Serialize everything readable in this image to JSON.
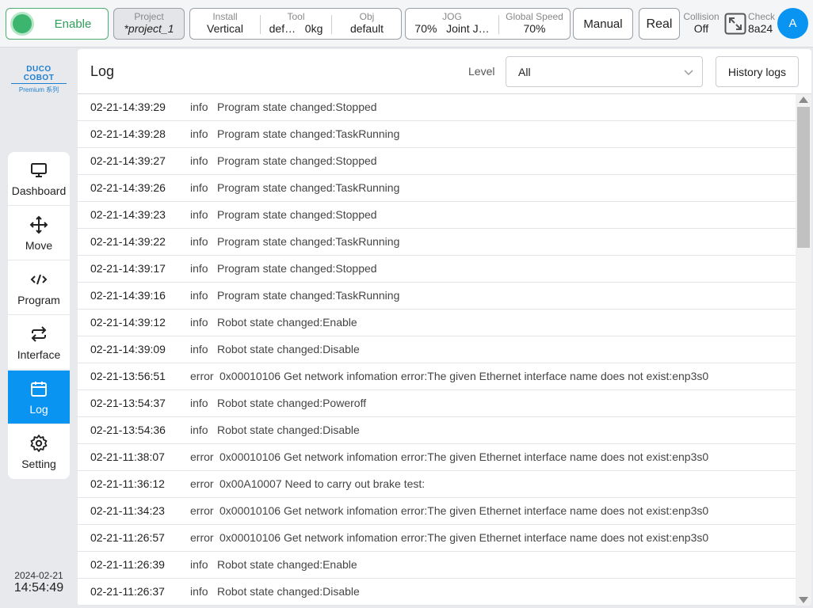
{
  "topbar": {
    "enable_label": "Enable",
    "project": {
      "caption": "Project",
      "value": "*project_1"
    },
    "install": {
      "caption": "Install",
      "value": "Vertical"
    },
    "tool": {
      "caption": "Tool",
      "value_name": "def…",
      "value_load": "0kg"
    },
    "obj": {
      "caption": "Obj",
      "value": "default"
    },
    "jog": {
      "caption": "JOG",
      "value_percent": "70%",
      "value_mode": "Joint J…"
    },
    "global_speed": {
      "caption": "Global Speed",
      "value": "70%"
    },
    "mode_label": "Manual",
    "real_label": "Real",
    "collision": {
      "caption": "Collision",
      "value": "Off"
    },
    "check": {
      "caption": "Check",
      "value": "8a24"
    },
    "avatar_letter": "A"
  },
  "logo": {
    "brand": "DUCO COBOT",
    "sub": "Premium 系列"
  },
  "nav": {
    "items": [
      {
        "label": "Dashboard",
        "icon": "monitor-icon"
      },
      {
        "label": "Move",
        "icon": "move-arrows-icon"
      },
      {
        "label": "Program",
        "icon": "code-icon"
      },
      {
        "label": "Interface",
        "icon": "swap-arrows-icon"
      },
      {
        "label": "Log",
        "icon": "calendar-icon"
      },
      {
        "label": "Setting",
        "icon": "gear-icon"
      }
    ],
    "active": "Log"
  },
  "datetime": {
    "date": "2024-02-21",
    "time": "14:54:49"
  },
  "log_panel": {
    "title": "Log",
    "level_label": "Level",
    "level_value": "All",
    "history_label": "History logs",
    "rows": [
      {
        "time": "02-21-14:39:29",
        "level": "info",
        "message": "Program state changed:Stopped"
      },
      {
        "time": "02-21-14:39:28",
        "level": "info",
        "message": "Program state changed:TaskRunning"
      },
      {
        "time": "02-21-14:39:27",
        "level": "info",
        "message": "Program state changed:Stopped"
      },
      {
        "time": "02-21-14:39:26",
        "level": "info",
        "message": "Program state changed:TaskRunning"
      },
      {
        "time": "02-21-14:39:23",
        "level": "info",
        "message": "Program state changed:Stopped"
      },
      {
        "time": "02-21-14:39:22",
        "level": "info",
        "message": "Program state changed:TaskRunning"
      },
      {
        "time": "02-21-14:39:17",
        "level": "info",
        "message": "Program state changed:Stopped"
      },
      {
        "time": "02-21-14:39:16",
        "level": "info",
        "message": "Program state changed:TaskRunning"
      },
      {
        "time": "02-21-14:39:12",
        "level": "info",
        "message": "Robot state changed:Enable"
      },
      {
        "time": "02-21-14:39:09",
        "level": "info",
        "message": "Robot state changed:Disable"
      },
      {
        "time": "02-21-13:56:51",
        "level": "error",
        "message": "0x00010106 Get network infomation error:The given Ethernet interface name does not exist:enp3s0"
      },
      {
        "time": "02-21-13:54:37",
        "level": "info",
        "message": "Robot state changed:Poweroff"
      },
      {
        "time": "02-21-13:54:36",
        "level": "info",
        "message": "Robot state changed:Disable"
      },
      {
        "time": "02-21-11:38:07",
        "level": "error",
        "message": "0x00010106 Get network infomation error:The given Ethernet interface name does not exist:enp3s0"
      },
      {
        "time": "02-21-11:36:12",
        "level": "error",
        "message": "0x00A10007 Need to carry out brake test:"
      },
      {
        "time": "02-21-11:34:23",
        "level": "error",
        "message": "0x00010106 Get network infomation error:The given Ethernet interface name does not exist:enp3s0"
      },
      {
        "time": "02-21-11:26:57",
        "level": "error",
        "message": "0x00010106 Get network infomation error:The given Ethernet interface name does not exist:enp3s0"
      },
      {
        "time": "02-21-11:26:39",
        "level": "info",
        "message": "Robot state changed:Enable"
      },
      {
        "time": "02-21-11:26:37",
        "level": "info",
        "message": "Robot state changed:Disable"
      }
    ]
  },
  "colors": {
    "accent": "#0a94f2",
    "enable_green": "#3cb56e"
  }
}
